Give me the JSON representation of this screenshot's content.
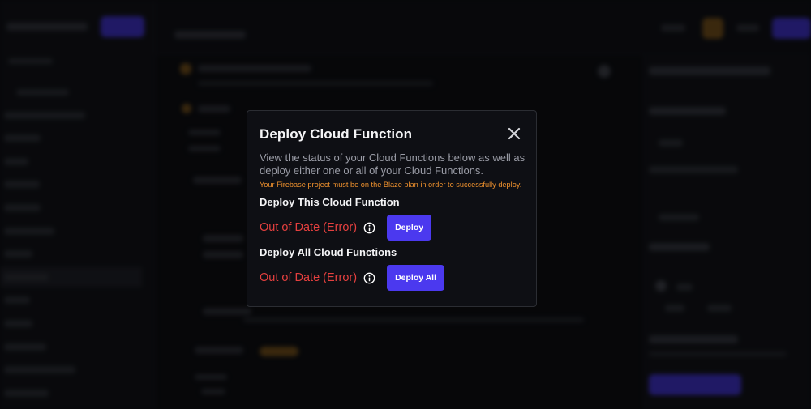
{
  "modal": {
    "title": "Deploy Cloud Function",
    "close_icon": "close-icon",
    "description": "View the status of your Cloud Functions below as well as deploy either one or all of your Cloud Functions.",
    "warning": "Your Firebase project must be on the Blaze plan in order to successfully deploy.",
    "single": {
      "heading": "Deploy This Cloud Function",
      "status": "Out of Date (Error)",
      "info_icon": "info-icon",
      "button_label": "Deploy"
    },
    "all": {
      "heading": "Deploy All Cloud Functions",
      "status": "Out of Date (Error)",
      "info_icon": "info-icon",
      "button_label": "Deploy All"
    }
  },
  "colors": {
    "accent": "#4b39ef",
    "error": "#e5403f",
    "warning": "#f0922e",
    "modal_bg": "#0e0f14"
  }
}
